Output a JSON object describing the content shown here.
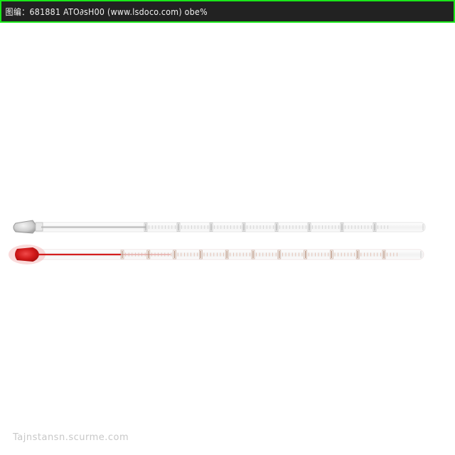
{
  "header": {
    "caption": "图编：681881  ATO∂sH00 (www.lsdoco.com)  obe%"
  },
  "watermark": {
    "text": "Tajnstansn.scurme.com"
  },
  "thermometers": [
    {
      "name": "clear",
      "liquid_color": "#9e9e9e",
      "bulb_color": "#c9c9c9"
    },
    {
      "name": "red",
      "liquid_color": "#d41e1e",
      "bulb_color": "#d11a1a"
    }
  ],
  "colors": {
    "topbar_background": "#222222",
    "topbar_border": "#19e619",
    "background": "#ffffff"
  }
}
